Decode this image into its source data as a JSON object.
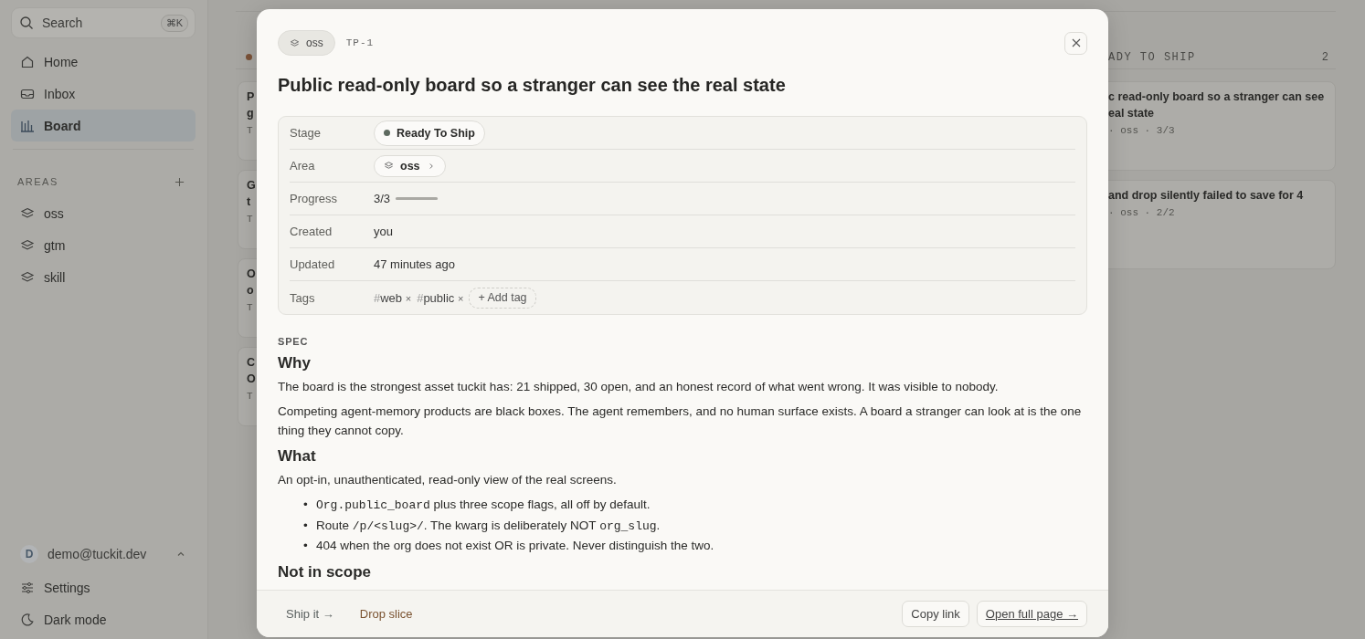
{
  "sidebar": {
    "search": {
      "placeholder": "Search",
      "shortcut": "⌘K"
    },
    "nav": [
      {
        "label": "Home",
        "selected": false
      },
      {
        "label": "Inbox",
        "selected": false
      },
      {
        "label": "Board",
        "selected": true
      }
    ],
    "areas_label": "AREAS",
    "areas": [
      {
        "label": "oss"
      },
      {
        "label": "gtm"
      },
      {
        "label": "skill"
      }
    ],
    "user": {
      "avatar": "D",
      "email": "demo@tuckit.dev"
    },
    "footer": [
      {
        "label": "Settings"
      },
      {
        "label": "Dark mode"
      }
    ]
  },
  "board": {
    "columns": [
      {
        "color": "#7a5238",
        "cards": [
          {
            "lines": [
              "P",
              "g"
            ],
            "meta": "T"
          },
          {
            "lines": [
              "G",
              "t"
            ],
            "meta": "T"
          },
          {
            "lines": [
              "O",
              "o"
            ],
            "meta": "T"
          },
          {
            "lines": [
              "C",
              "O"
            ],
            "meta": "T"
          }
        ]
      },
      {
        "title": "ADY TO SHIP",
        "count": "2",
        "cards": [
          {
            "lines": [
              "c read-only board so a stranger can see",
              "eal state"
            ],
            "meta": "· oss · 3/3"
          },
          {
            "lines": [
              "and drop silently failed to save for 4"
            ],
            "meta": "· oss · 2/2"
          }
        ]
      }
    ]
  },
  "modal": {
    "area_chip": "oss",
    "id": "TP-1",
    "title": "Public read-only board so a stranger can see the real state",
    "properties": [
      {
        "kind": "stage",
        "label": "Stage",
        "value": "Ready To Ship"
      },
      {
        "kind": "area",
        "label": "Area",
        "value": "oss"
      },
      {
        "kind": "progress",
        "label": "Progress",
        "value": "3/3",
        "level": 1
      },
      {
        "kind": "text",
        "label": "Created",
        "value": "you"
      },
      {
        "kind": "text",
        "label": "Updated",
        "value": "47 minutes ago"
      },
      {
        "kind": "tags",
        "label": "Tags",
        "tags": [
          {
            "hash": "#",
            "name": "web",
            "remove": "×"
          },
          {
            "hash": "#",
            "name": "public",
            "remove": "×"
          }
        ],
        "add": "+ Add tag"
      }
    ],
    "spec": {
      "label": "SPEC",
      "blocks": [
        {
          "kind": "h",
          "text": "Why"
        },
        {
          "kind": "p",
          "text": "The board is the strongest asset tuckit has: 21 shipped, 30 open, and an honest record of what went wrong. It was visible to nobody."
        },
        {
          "kind": "p",
          "text": "Competing agent-memory products are black boxes. The agent remembers, and no human surface exists. A board a stranger can look at is the one thing they cannot copy."
        },
        {
          "kind": "h",
          "text": "What"
        },
        {
          "kind": "p",
          "text": "An opt-in, unauthenticated, read-only view of the real screens."
        },
        {
          "kind": "ul",
          "marker": "•",
          "items": [
            [
              {
                "kind": "code",
                "text": "Org.public_board"
              },
              {
                "kind": "text",
                "text": " plus three scope flags, all off by default."
              }
            ],
            [
              {
                "kind": "text",
                "text": "Route "
              },
              {
                "kind": "code",
                "text": "/p/<slug>/"
              },
              {
                "kind": "text",
                "text": ". The kwarg is deliberately NOT "
              },
              {
                "kind": "code",
                "text": "org_slug"
              },
              {
                "kind": "text",
                "text": "."
              }
            ],
            [
              {
                "kind": "text",
                "text": "404 when the org does not exist OR is private. Never distinguish the two."
              }
            ]
          ]
        },
        {
          "kind": "h",
          "text": "Not in scope"
        }
      ]
    },
    "footer": {
      "left": [
        {
          "kind": "ship",
          "label": "Ship it →"
        },
        {
          "kind": "drop",
          "label": "Drop slice"
        }
      ],
      "right": [
        {
          "kind": "plain",
          "label": "Copy link"
        },
        {
          "kind": "link",
          "label": "Open full page →"
        }
      ]
    }
  }
}
